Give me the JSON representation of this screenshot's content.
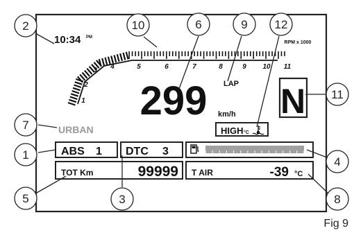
{
  "figure_label": "Fig 9",
  "display": {
    "clock_time": "10:34",
    "clock_period": "PM",
    "rpm_unit": "RPM x 1000",
    "rpm_scale": [
      "1",
      "2",
      "3",
      "4",
      "5",
      "6",
      "7",
      "8",
      "9",
      "10",
      "11"
    ],
    "speed": "299",
    "speed_unit": "km/h",
    "lap_label": "LAP",
    "gear": "N",
    "riding_mode": "URBAN",
    "temp_warning": "HIGH",
    "temp_warning_unit": "°C",
    "abs_label": "ABS",
    "abs_value": "1",
    "dtc_label": "DTC",
    "dtc_value": "3",
    "fuel_level": 1.0,
    "odometer_label": "TOT Km",
    "odometer_value": "99999",
    "air_temp_label": "T AIR",
    "air_temp_value": "-39",
    "air_temp_unit": "°C"
  },
  "callouts": [
    "1",
    "2",
    "3",
    "4",
    "5",
    "6",
    "7",
    "8",
    "9",
    "10",
    "11",
    "12"
  ],
  "colors": {
    "line": "#222222",
    "mode_text": "#9a9a9a",
    "fuel_bar": "#a0a0a0"
  },
  "icons": [
    "fuel-pump-icon",
    "coolant-temperature-icon"
  ]
}
